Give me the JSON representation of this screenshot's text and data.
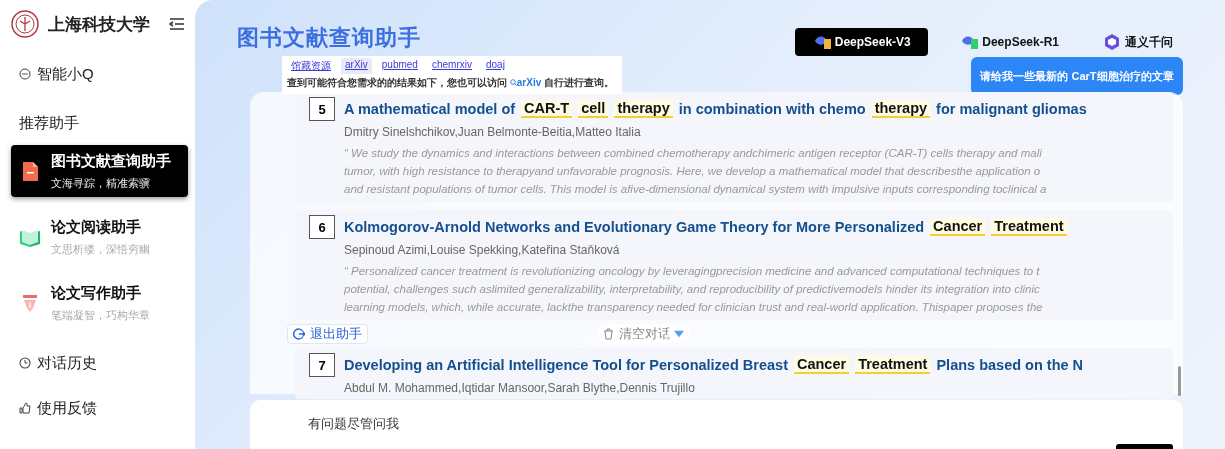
{
  "sidebar": {
    "brand": "上海科技大学",
    "top_link": "智能小Q",
    "section_title": "推荐助手",
    "assistants": [
      {
        "title": "图书文献查询助手",
        "subtitle": "文海寻踪，精准索骥",
        "selected": true
      },
      {
        "title": "论文阅读助手",
        "subtitle": "文思析缕，深悟穷幽",
        "selected": false
      },
      {
        "title": "论文写作助手",
        "subtitle": "笔端凝智，巧构华章",
        "selected": false
      }
    ],
    "bottom_links": [
      "对话历史",
      "使用反馈"
    ]
  },
  "main": {
    "title": "图书文献查询助手",
    "models": [
      {
        "label": "DeepSeek-V3",
        "selected": true
      },
      {
        "label": "DeepSeek-R1",
        "selected": false
      },
      {
        "label": "通义千问",
        "selected": false
      }
    ],
    "prompt_bubble": "请给我一些最新的 CarT细胞治疗的文章",
    "sources": {
      "tabs": [
        {
          "label": "馆藏资源",
          "selected": false
        },
        {
          "label": "arXiv",
          "selected": true
        },
        {
          "label": "pubmed",
          "selected": false
        },
        {
          "label": "chemrxiv",
          "selected": false
        },
        {
          "label": "doaj",
          "selected": false
        }
      ],
      "message_before": "查到可能符合您需求的的结果如下，您也可以访问",
      "message_link": "arXiv",
      "message_after": "自行进行查询。"
    },
    "results": [
      {
        "index": "5",
        "title": [
          {
            "text": "A mathematical model of",
            "highlight": false
          },
          {
            "text": "CAR-T",
            "highlight": true
          },
          {
            "text": "cell",
            "highlight": true
          },
          {
            "text": "therapy",
            "highlight": true
          },
          {
            "text": "in combination with chemo",
            "highlight": false
          },
          {
            "text": "therapy",
            "highlight": true
          },
          {
            "text": "for malignant gliomas",
            "highlight": false
          }
        ],
        "authors": "Dmitry Sinelshchikov,Juan Belmonte-Beitia,Matteo Italia",
        "abstract": [
          "“ We study the dynamics and interactions between combined chemotherapy andchimeric antigen receptor (CAR-T) cells therapy and mali",
          "tumor, with high resistance to therapyand unfavorable prognosis. Here, we develop a mathematical model that describesthe application o",
          "and resistant populations of tumor cells. This model is afive-dimensional dynamical system with impulsive inputs corresponding toclinical a"
        ]
      },
      {
        "index": "6",
        "title": [
          {
            "text": "Kolmogorov-Arnold Networks and Evolutionary Game Theory for More Personalized",
            "highlight": false
          },
          {
            "text": "Cancer",
            "highlight": true
          },
          {
            "text": "Treatment",
            "highlight": true
          }
        ],
        "authors": "Sepinoud Azimi,Louise Spekking,Kateřina Staňková",
        "abstract": [
          "“ Personalized cancer treatment is revolutionizing oncology by leveragingprecision medicine and advanced computational techniques to t",
          "potential, challenges such aslimited generalizability, interpretability, and reproducibility of predictivemodels hinder its integration into clinic",
          "learning models, which, while accurate, lackthe transparency needed for clinician trust and real-world application. Thispaper proposes the"
        ]
      },
      {
        "index": "7",
        "title": [
          {
            "text": "Developing an Artificial Intelligence Tool for Personalized Breast",
            "highlight": false
          },
          {
            "text": "Cancer",
            "highlight": true
          },
          {
            "text": "Treatment",
            "highlight": true
          },
          {
            "text": "Plans based on the N",
            "highlight": false
          }
        ],
        "authors": "Abdul M. Mohammed,Iqtidar Mansoor,Sarah Blythe,Dennis Trujillo"
      }
    ],
    "exit_button": "退出助手",
    "clear_button": "清空对话",
    "input_placeholder": "有问题尽管问我"
  }
}
